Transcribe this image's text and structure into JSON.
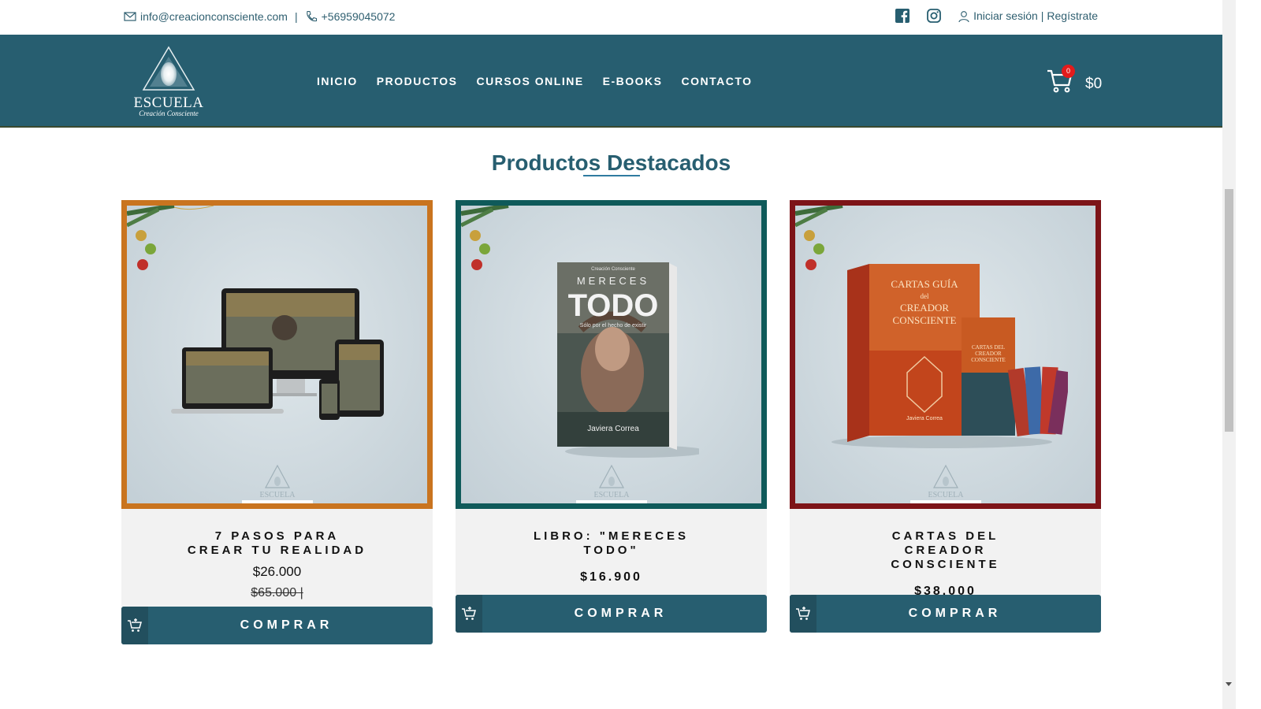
{
  "topbar": {
    "email": "info@creacionconsciente.com",
    "separator": "|",
    "phone": "+56959045072",
    "login": "Iniciar sesión",
    "auth_separator": "|",
    "register": "Regístrate"
  },
  "header": {
    "logo_title": "ESCUELA",
    "logo_subtitle": "Creación Consciente",
    "nav": [
      {
        "label": "INICIO"
      },
      {
        "label": "PRODUCTOS"
      },
      {
        "label": "CURSOS ONLINE"
      },
      {
        "label": "E-BOOKS"
      },
      {
        "label": "CONTACTO"
      }
    ],
    "cart_count": "0",
    "cart_total": "$0",
    "bg_color": "#275e70"
  },
  "section": {
    "title": "Productos Destacados"
  },
  "products": [
    {
      "name": "7 PASOS PARA CREAR TU REALIDAD",
      "price": "$26.000",
      "old_price": "$65.000 |",
      "border_color": "#c9741f",
      "button": "COMPRAR"
    },
    {
      "name": "LIBRO: \"MERECES TODO\"",
      "price": "$16.900",
      "border_color": "#0f5a5a",
      "button": "COMPRAR",
      "cover_brand": "Creación Consciente",
      "cover_title_top": "MERECES",
      "cover_title": "TODO",
      "cover_tagline": "Sólo por el hecho de existir",
      "cover_author": "Javiera Correa"
    },
    {
      "name": "CARTAS DEL CREADOR CONSCIENTE",
      "price": "$38.000",
      "border_color": "#7d1418",
      "button": "COMPRAR",
      "box_title_1": "CARTAS GUÍA",
      "box_title_2": "del",
      "box_title_3": "CREADOR",
      "box_title_4": "CONSCIENTE",
      "box2_title": "CARTAS DEL CREADOR CONSCIENTE",
      "box_author": "Javiera Correa"
    }
  ],
  "watermark_text": "ESCUELA"
}
